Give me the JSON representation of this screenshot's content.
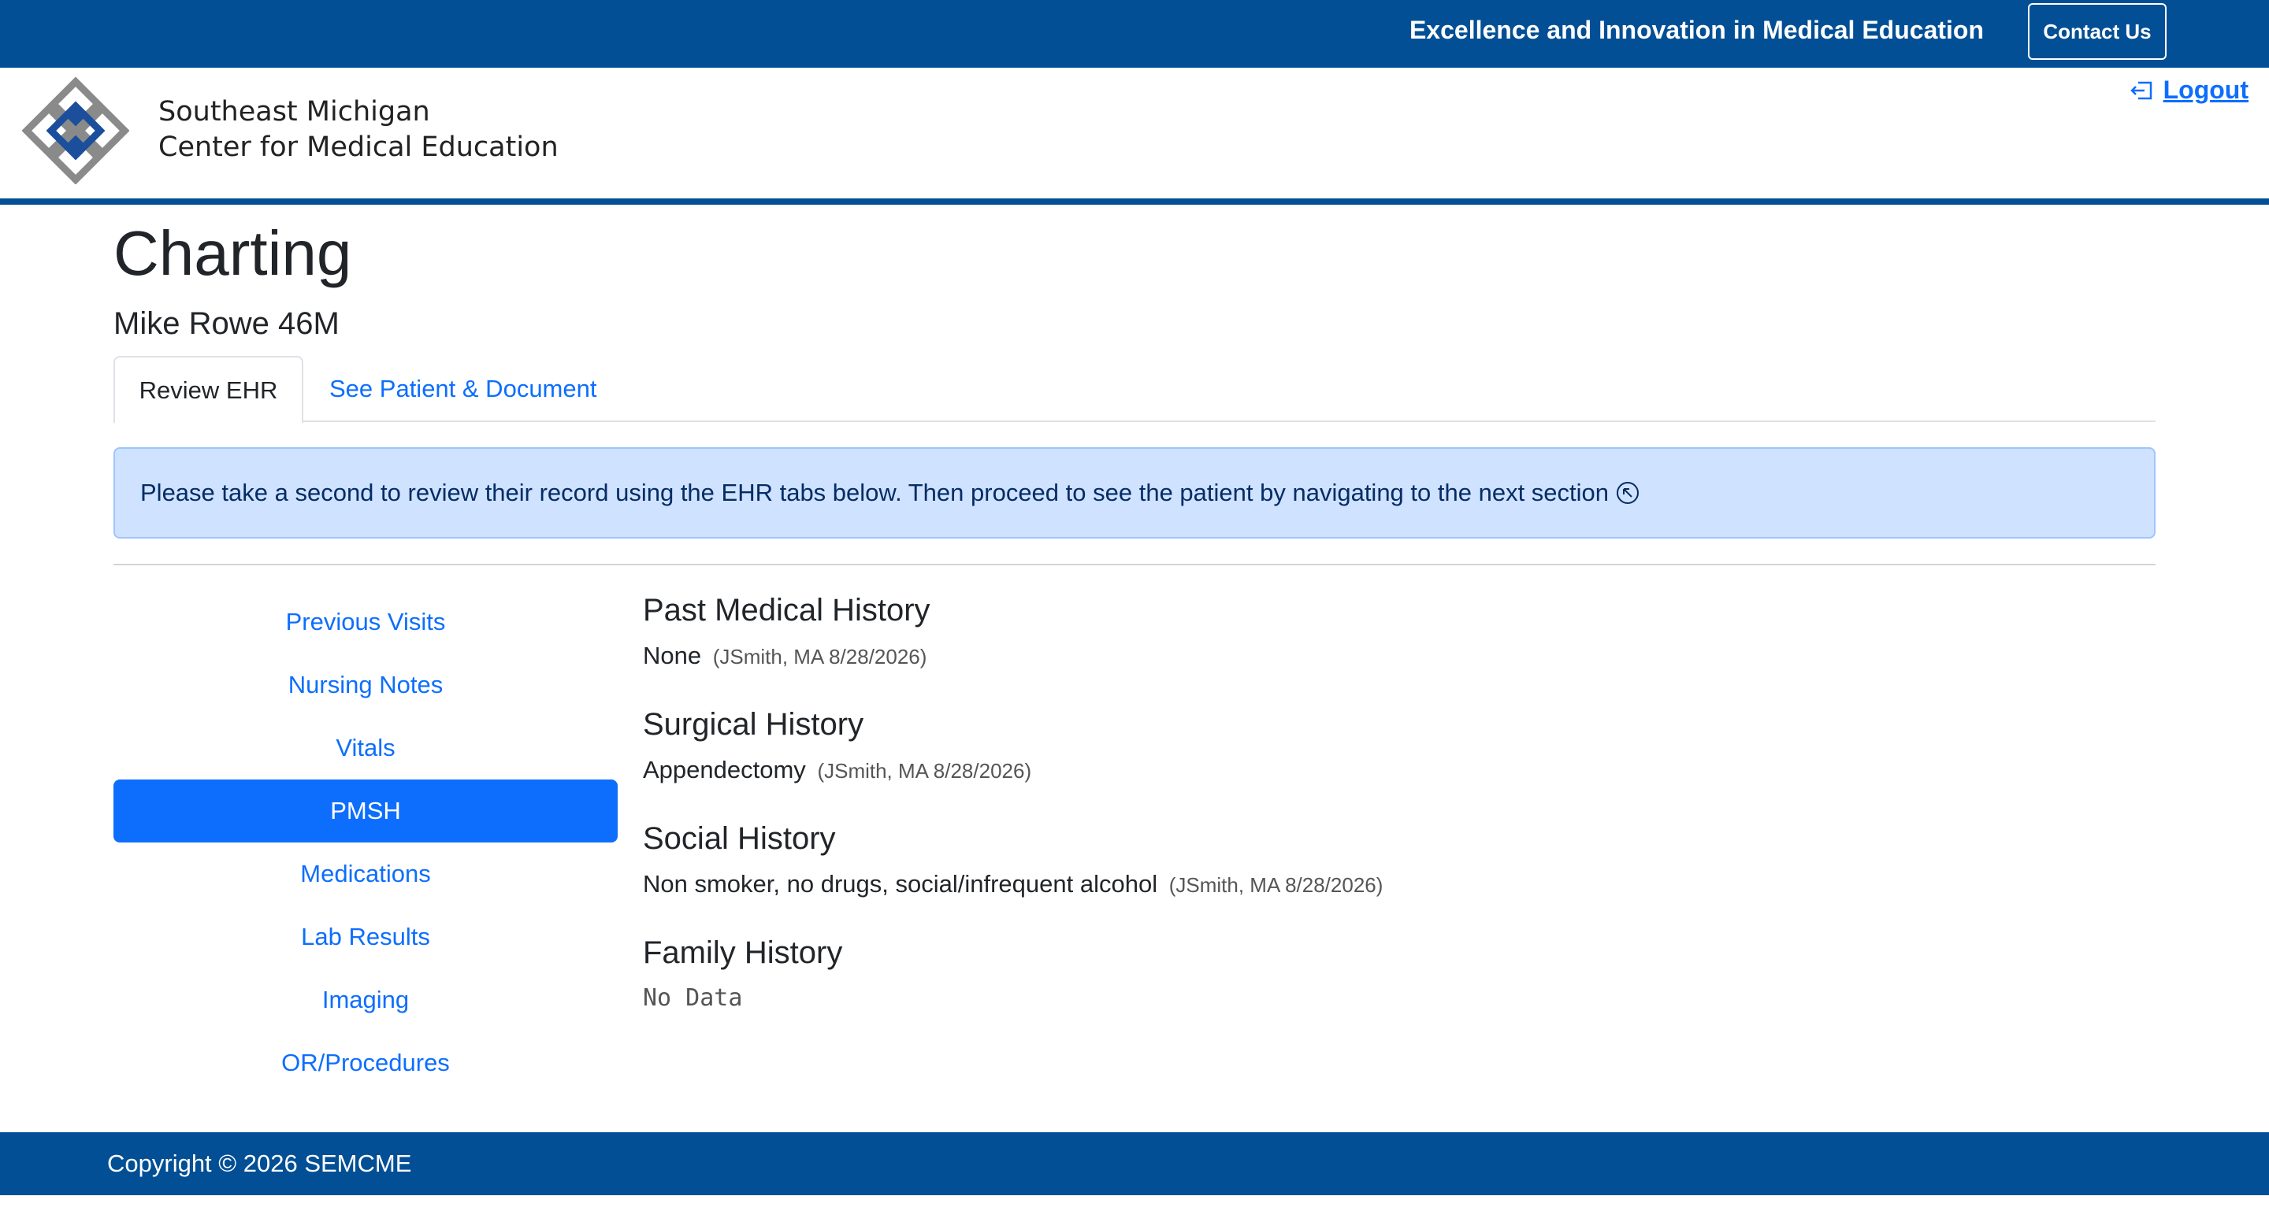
{
  "topbar": {
    "tagline": "Excellence and Innovation in Medical Education",
    "contact_label": "Contact Us"
  },
  "header": {
    "org_line1": "Southeast Michigan",
    "org_line2": "Center for Medical Education",
    "logout_label": "Logout"
  },
  "page": {
    "title": "Charting",
    "patient": "Mike Rowe 46M"
  },
  "tabs": [
    {
      "label": "Review EHR",
      "active": true
    },
    {
      "label": "See Patient & Document",
      "active": false
    }
  ],
  "alert": {
    "text": "Please take a second to review their record using the EHR tabs below. Then proceed to see the patient by navigating to the next section"
  },
  "sidebar": {
    "items": [
      {
        "label": "Previous Visits"
      },
      {
        "label": "Nursing Notes"
      },
      {
        "label": "Vitals"
      },
      {
        "label": "PMSH",
        "active": true
      },
      {
        "label": "Medications"
      },
      {
        "label": "Lab Results"
      },
      {
        "label": "Imaging"
      },
      {
        "label": "OR/Procedures"
      }
    ]
  },
  "pmsh": {
    "past_medical": {
      "title": "Past Medical History",
      "value": "None",
      "meta": "(JSmith, MA 8/28/2026)"
    },
    "surgical": {
      "title": "Surgical History",
      "value": "Appendectomy",
      "meta": "(JSmith, MA 8/28/2026)"
    },
    "social": {
      "title": "Social History",
      "value": "Non smoker, no drugs, social/infrequent alcohol",
      "meta": "(JSmith, MA 8/28/2026)"
    },
    "family": {
      "title": "Family History",
      "value": "No Data"
    }
  },
  "footer": {
    "copyright": "Copyright © 2026 SEMCME"
  },
  "colors": {
    "brand_blue": "#024f95",
    "link_blue": "#0d6efd",
    "alert_bg": "#cfe2ff"
  }
}
